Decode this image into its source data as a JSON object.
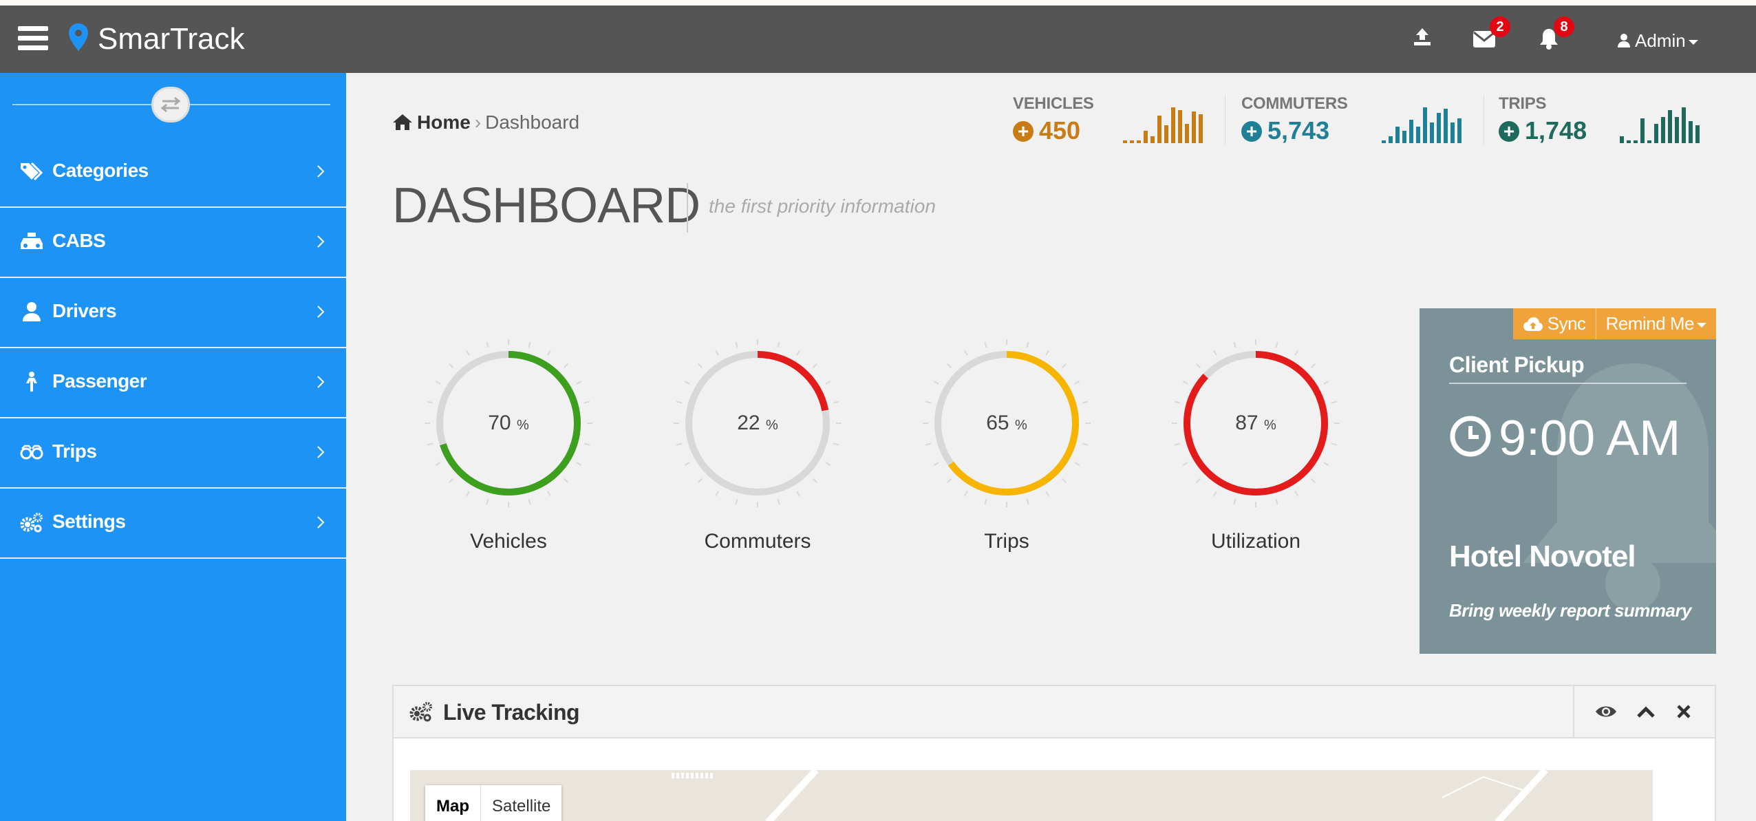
{
  "app": {
    "brand": "SmarTrack"
  },
  "topbar": {
    "messages_badge": "2",
    "notifications_badge": "8",
    "user_label": "Admin"
  },
  "sidebar": {
    "items": [
      {
        "label": "Categories",
        "icon": "tags-icon"
      },
      {
        "label": "CABS",
        "icon": "cab-icon"
      },
      {
        "label": "Drivers",
        "icon": "user-icon"
      },
      {
        "label": "Passenger",
        "icon": "passenger-icon"
      },
      {
        "label": "Trips",
        "icon": "binoculars-icon"
      },
      {
        "label": "Settings",
        "icon": "gears-icon"
      }
    ]
  },
  "breadcrumb": {
    "home": "Home",
    "current": "Dashboard"
  },
  "stats": [
    {
      "label": "VEHICLES",
      "value": "450",
      "color": "#c77c14"
    },
    {
      "label": "COMMUTERS",
      "value": "5,743",
      "color": "#1f7f97"
    },
    {
      "label": "TRIPS",
      "value": "1,748",
      "color": "#1e6b5d"
    }
  ],
  "page": {
    "title": "DASHBOARD",
    "subtitle": "the first priority information"
  },
  "gauges": [
    {
      "label": "Vehicles",
      "value": "70",
      "percent": 70,
      "unit": "%",
      "color": "#3d9f1e"
    },
    {
      "label": "Commuters",
      "value": "22",
      "percent": 22,
      "unit": "%",
      "color": "#e31b1b"
    },
    {
      "label": "Trips",
      "value": "65",
      "percent": 65,
      "unit": "%",
      "color": "#f7b500"
    },
    {
      "label": "Utilization",
      "value": "87",
      "percent": 87,
      "unit": "%",
      "color": "#e31b1b"
    }
  ],
  "card": {
    "sync_label": "Sync",
    "remind_label": "Remind Me",
    "title": "Client Pickup",
    "time": "9:00 AM",
    "place": "Hotel Novotel",
    "note": "Bring weekly report summary"
  },
  "panel": {
    "title": "Live Tracking",
    "map_label": "Map",
    "satellite_label": "Satellite"
  }
}
